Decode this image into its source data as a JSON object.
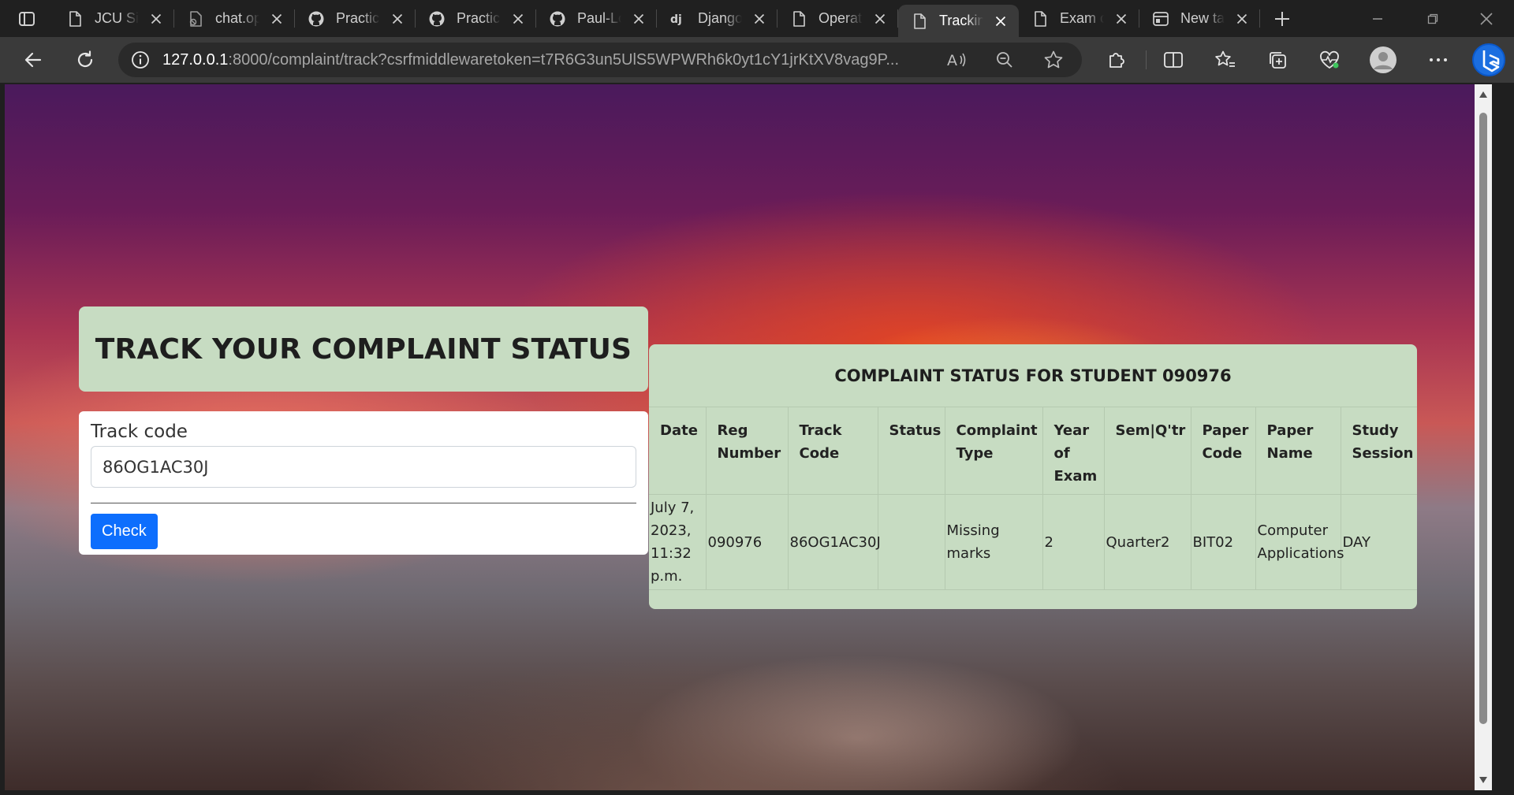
{
  "browser": {
    "tabs": [
      {
        "title": "JCU Sir",
        "icon": "page-icon",
        "active": false
      },
      {
        "title": "chat.op",
        "icon": "broken-page-icon",
        "active": false
      },
      {
        "title": "Practic",
        "icon": "github-icon",
        "active": false
      },
      {
        "title": "Practic",
        "icon": "github-icon",
        "active": false
      },
      {
        "title": "Paul-Lo",
        "icon": "github-icon",
        "active": false
      },
      {
        "title": "Django",
        "icon": "django-icon",
        "active": false
      },
      {
        "title": "Operat",
        "icon": "page-icon",
        "active": false
      },
      {
        "title": "Trackin",
        "icon": "page-icon",
        "active": true
      },
      {
        "title": "Exam c",
        "icon": "page-icon",
        "active": false
      },
      {
        "title": "New ta",
        "icon": "newtab-icon",
        "active": false
      }
    ],
    "url_host": "127.0.0.1",
    "url_rest": ":8000/complaint/track?csrfmiddlewaretoken=t7R6G3un5UlS5WPWRh6k0yt1cY1jrKtXV8vag9P..."
  },
  "page": {
    "heading": "TRACK YOUR COMPLAINT STATUS",
    "form": {
      "label": "Track code",
      "value": "86OG1AC30J",
      "submit_label": "Check"
    },
    "result": {
      "title": "COMPLAINT STATUS FOR STUDENT 090976",
      "columns": [
        "Date",
        "Reg Number",
        "Track Code",
        "Status",
        "Complaint Type",
        "Year of Exam",
        "Sem|Q'tr",
        "Paper Code",
        "Paper Name",
        "Study Session"
      ],
      "rows": [
        [
          "July 7, 2023, 11:32 p.m.",
          "090976",
          "86OG1AC30J",
          "",
          "Missing marks",
          "2",
          "Quarter2",
          "BIT02",
          "Computer Applications",
          "DAY"
        ]
      ]
    }
  },
  "colors": {
    "card_bg": "#c7dcc2",
    "button_primary": "#0d6efd",
    "browser_chrome": "#202020"
  }
}
